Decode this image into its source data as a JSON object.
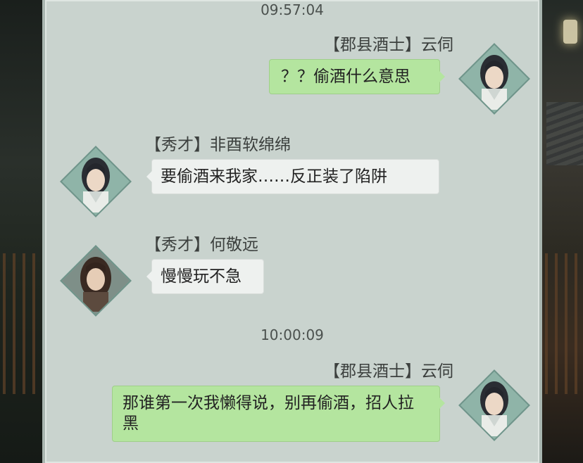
{
  "messages": [
    {
      "type": "time",
      "text": "09:57:04"
    },
    {
      "type": "msg",
      "side": "self",
      "sender": "【郡县酒士】云伺",
      "text": "？？偷酒什么意思",
      "avatar": "dark-hair-scholar-portrait"
    },
    {
      "type": "msg",
      "side": "other",
      "sender": "【秀才】非酉软绵绵",
      "text": "要偷酒来我家……反正装了陷阱",
      "avatar": "dark-hair-scholar-portrait"
    },
    {
      "type": "msg",
      "side": "other",
      "sender": "【秀才】何敬远",
      "text": "慢慢玩不急",
      "avatar": "long-hair-man-portrait"
    },
    {
      "type": "time",
      "text": "10:00:09"
    },
    {
      "type": "msg",
      "side": "self",
      "sender": "【郡县酒士】云伺",
      "text": "那谁第一次我懒得说，别再偷酒，招人拉黑",
      "avatar": "dark-hair-scholar-portrait"
    }
  ],
  "colors": {
    "self_bubble": "#b4e59f",
    "other_bubble": "#eef1ef",
    "panel_bg": "#c9d3ce"
  }
}
